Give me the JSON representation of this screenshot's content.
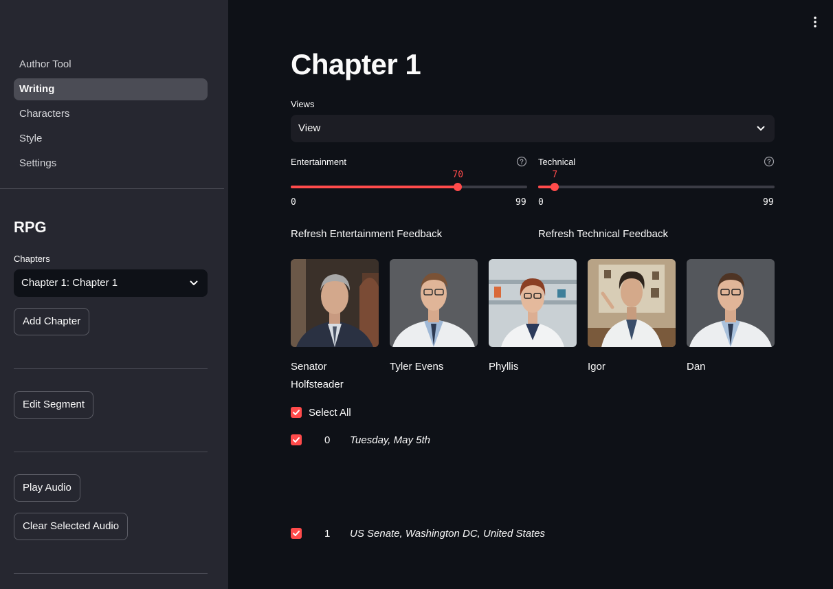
{
  "sidebar": {
    "nav": [
      {
        "label": "Author Tool",
        "active": false
      },
      {
        "label": "Writing",
        "active": true
      },
      {
        "label": "Characters",
        "active": false
      },
      {
        "label": "Style",
        "active": false
      },
      {
        "label": "Settings",
        "active": false
      }
    ],
    "project_title": "RPG",
    "chapters_label": "Chapters",
    "chapter_selected": "Chapter 1: Chapter 1",
    "add_chapter_label": "Add Chapter",
    "edit_segment_label": "Edit Segment",
    "play_audio_label": "Play Audio",
    "clear_audio_label": "Clear Selected Audio"
  },
  "main": {
    "title": "Chapter 1",
    "views_label": "Views",
    "views_selected": "View",
    "sliders": [
      {
        "label": "Entertainment",
        "value": "70",
        "min": "0",
        "max": "99"
      },
      {
        "label": "Technical",
        "value": "7",
        "min": "0",
        "max": "99"
      }
    ],
    "refresh_entertainment_label": "Refresh Entertainment Feedback",
    "refresh_technical_label": "Refresh Technical Feedback",
    "characters": [
      {
        "name": "Senator Holfsteader"
      },
      {
        "name": "Tyler Evens"
      },
      {
        "name": "Phyllis"
      },
      {
        "name": "Igor"
      },
      {
        "name": "Dan"
      }
    ],
    "select_all_label": "Select All",
    "segments": [
      {
        "index": "0",
        "text": "Tuesday, May 5th",
        "checked": true
      },
      {
        "index": "1",
        "text": "US Senate, Washington DC, United States",
        "checked": true
      }
    ]
  },
  "colors": {
    "accent": "#ff4b4b",
    "background": "#0e1117",
    "sidebar": "#262730"
  }
}
